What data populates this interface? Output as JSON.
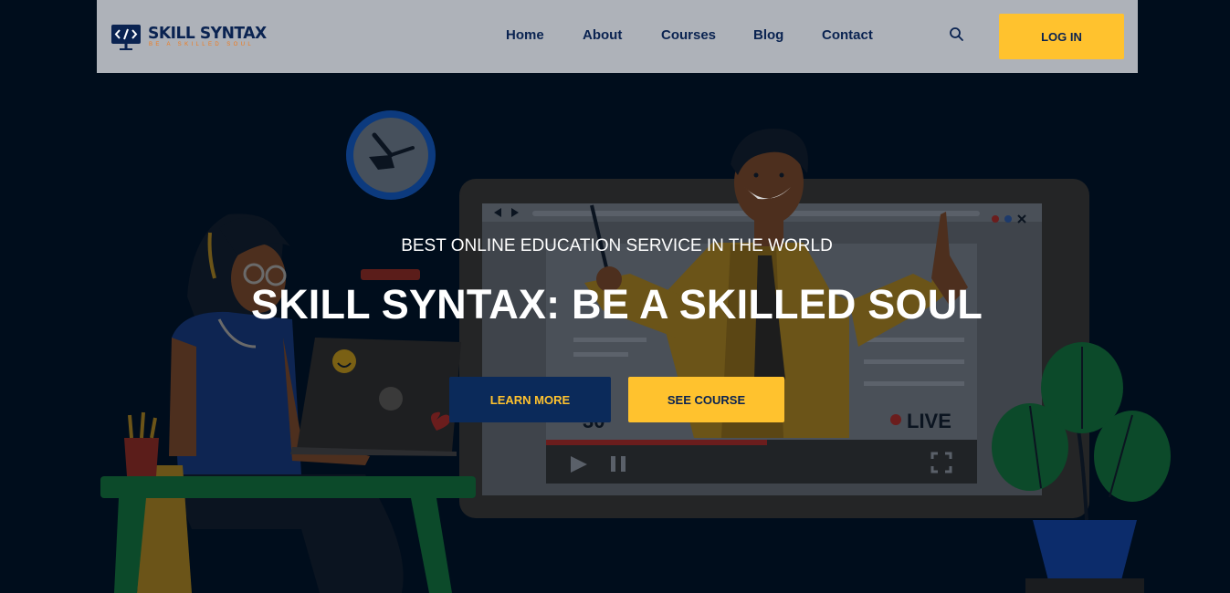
{
  "brand": {
    "name": "SKILL SYNTAX",
    "tagline": "BE A SKILLED SOUL",
    "logo_icon": "code-monitor-icon"
  },
  "nav": {
    "items": [
      "Home",
      "About",
      "Courses",
      "Blog",
      "Contact"
    ],
    "search_icon": "search-icon",
    "login_label": "LOG IN"
  },
  "hero": {
    "subtitle": "BEST ONLINE EDUCATION SERVICE IN THE WORLD",
    "title": "SKILL SYNTAX: BE A SKILLED SOUL",
    "learn_more_label": "LEARN MORE",
    "see_course_label": "SEE COURSE"
  },
  "illustration": {
    "live_label": "LIVE",
    "viewer_count": "30"
  },
  "colors": {
    "header_bg": "#aeb2b9",
    "page_bg": "#000d1c",
    "navy": "#0a2351",
    "accent_yellow": "#ffc22e",
    "tagline_orange": "#f27a1a"
  }
}
